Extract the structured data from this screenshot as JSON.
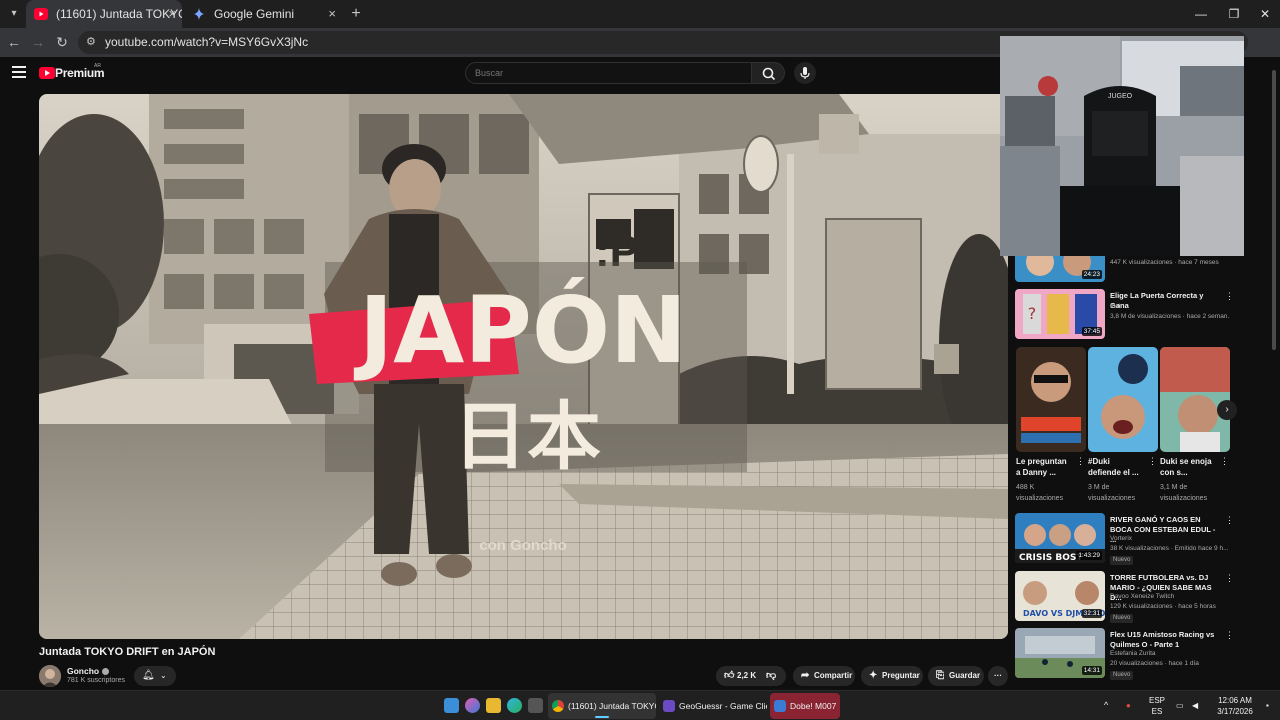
{
  "browser": {
    "tabs": [
      {
        "title": "(11601) Juntada TOKYO DRIFT e",
        "active": true
      },
      {
        "title": "Google Gemini",
        "active": false
      }
    ],
    "close_glyph": "×",
    "new_tab_glyph": "+",
    "url": "youtube.com/watch?v=MSY6GvX3jNc"
  },
  "youtube": {
    "logo_text": "Premium",
    "country_code": "AR",
    "search_placeholder": "Buscar",
    "video": {
      "title": "Juntada TOKYO DRIFT en JAPÓN",
      "overlay_title": "JAPÓN",
      "overlay_kanji": "日本",
      "overlay_credit": "con Goncho"
    },
    "channel": {
      "name": "Goncho",
      "subscribers": "781 K suscriptores"
    },
    "actions": {
      "likes": "2,2 K",
      "share": "Compartir",
      "ask": "Preguntar",
      "save": "Guardar",
      "more": "···"
    },
    "sidebar": {
      "top_item": {
        "meta": "447 K visualizaciones · hace 7 meses",
        "duration": "24:23"
      },
      "item2": {
        "title": "Elige La Puerta Correcta y Gana",
        "channel": "Ibai",
        "meta": "3,8 M de visualizaciones · hace 2 seman...",
        "duration": "37:45"
      },
      "shorts": [
        {
          "title": "Le preguntan a Danny ...",
          "views": "488 K visualizaciones"
        },
        {
          "title": "#Duki defiende el ...",
          "views": "3 M de visualizaciones"
        },
        {
          "title": "Duki se enoja con s...",
          "views": "3,1 M de visualizaciones"
        }
      ],
      "videos": [
        {
          "title": "RIVER GANÓ Y CAOS EN BOCA CON ESTEBAN EDUL - ...",
          "channel": "Vorterix",
          "meta": "38 K visualizaciones · Emitido hace 9 h...",
          "duration": "1:43:29",
          "badge": "Nuevo"
        },
        {
          "title": "TORRE FUTBOLERA vs. DJ MARIO - ¿QUIEN SABE MAS D...",
          "channel": "Davoo Xeneize Twitch",
          "meta": "129 K visualizaciones · hace 5 horas",
          "duration": "32:31",
          "badge": "Nuevo"
        },
        {
          "title": "Flex U15 Amistoso Racing vs Quilmes O - Parte 1",
          "channel": "Estefania Zurita",
          "meta": "20 visualizaciones · hace 1 día",
          "duration": "14:31",
          "badge": "Nuevo"
        }
      ]
    }
  },
  "taskbar": {
    "apps": [
      {
        "label": "(11601) Juntada TOKYO D"
      },
      {
        "label": "GeoGuessr - Game Clier"
      },
      {
        "label": "Dobe! M007"
      }
    ],
    "language": "ESP",
    "language_sub": "ES",
    "time": "12:06 AM",
    "date": "3/17/2026"
  },
  "colors": {
    "youtube_red": "#ff0033",
    "background": "#0f0f0f",
    "banner_red": "#e4294a"
  }
}
